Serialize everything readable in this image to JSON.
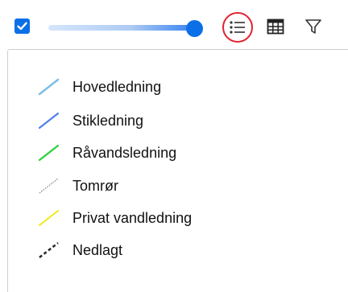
{
  "toolbar": {
    "visibility_checked": true,
    "opacity_level": 0.92,
    "icons": {
      "checkbox": "checkbox-checked-icon",
      "legend": "list-icon",
      "table": "table-icon",
      "filter": "filter-icon"
    },
    "accent_color": "#0b6fe8",
    "highlight_color": "#e2232f"
  },
  "legend": {
    "items": [
      {
        "label": "Hovedledning",
        "color": "#7fbfe6",
        "style": "solid"
      },
      {
        "label": "Stikledning",
        "color": "#4f7fe9",
        "style": "solid"
      },
      {
        "label": "Råvandsledning",
        "color": "#29d13a",
        "style": "solid"
      },
      {
        "label": "Tomrør",
        "color": "#8a8a8a",
        "style": "dotted"
      },
      {
        "label": "Privat vandledning",
        "color": "#f2ea1a",
        "style": "solid"
      },
      {
        "label": "Nedlagt",
        "color": "#2b2b2b",
        "style": "dashed"
      }
    ]
  }
}
